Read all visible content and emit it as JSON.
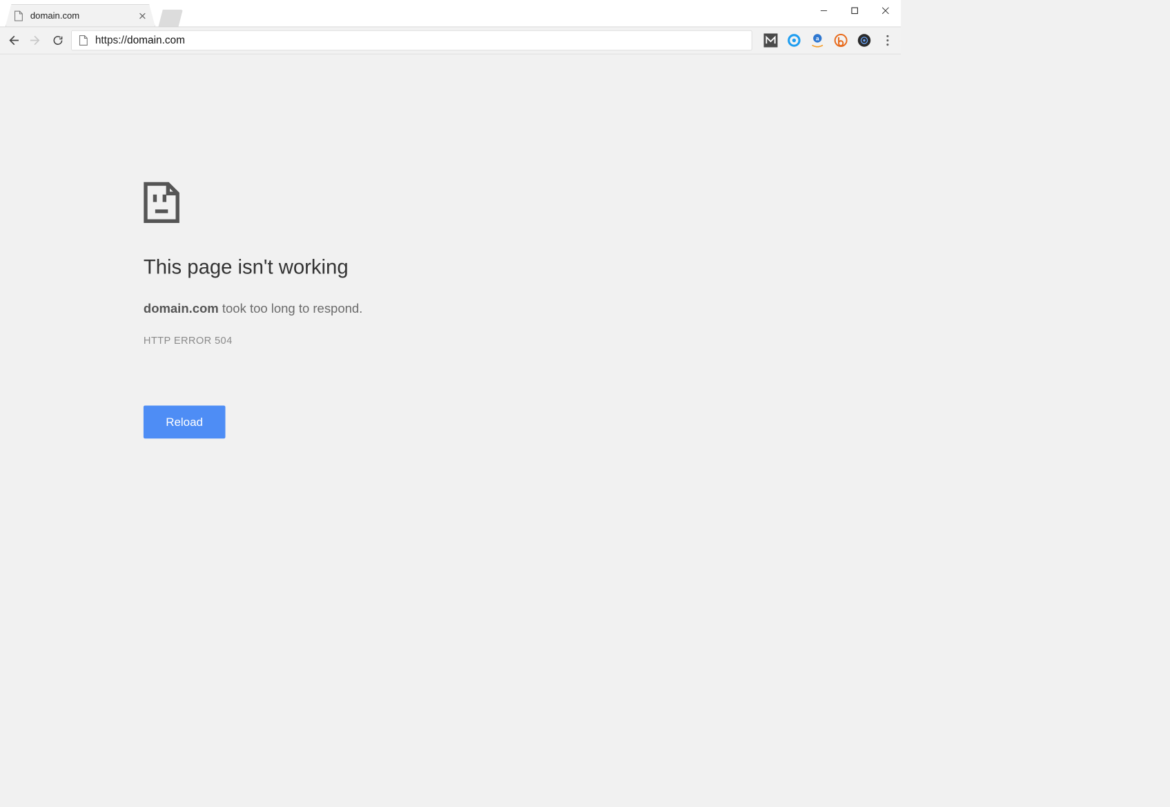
{
  "window": {
    "minimize_label": "Minimize",
    "maximize_label": "Maximize",
    "close_label": "Close"
  },
  "tab": {
    "title": "domain.com"
  },
  "toolbar": {
    "url_protocol": "https://",
    "url_host": "domain.com"
  },
  "extensions": {
    "items": [
      "mega",
      "ring-blue",
      "amazon-assistant",
      "bitly",
      "camera"
    ]
  },
  "error": {
    "title": "This page isn't working",
    "domain": "domain.com",
    "message_tail": " took too long to respond.",
    "code": "HTTP ERROR 504",
    "reload_label": "Reload"
  }
}
